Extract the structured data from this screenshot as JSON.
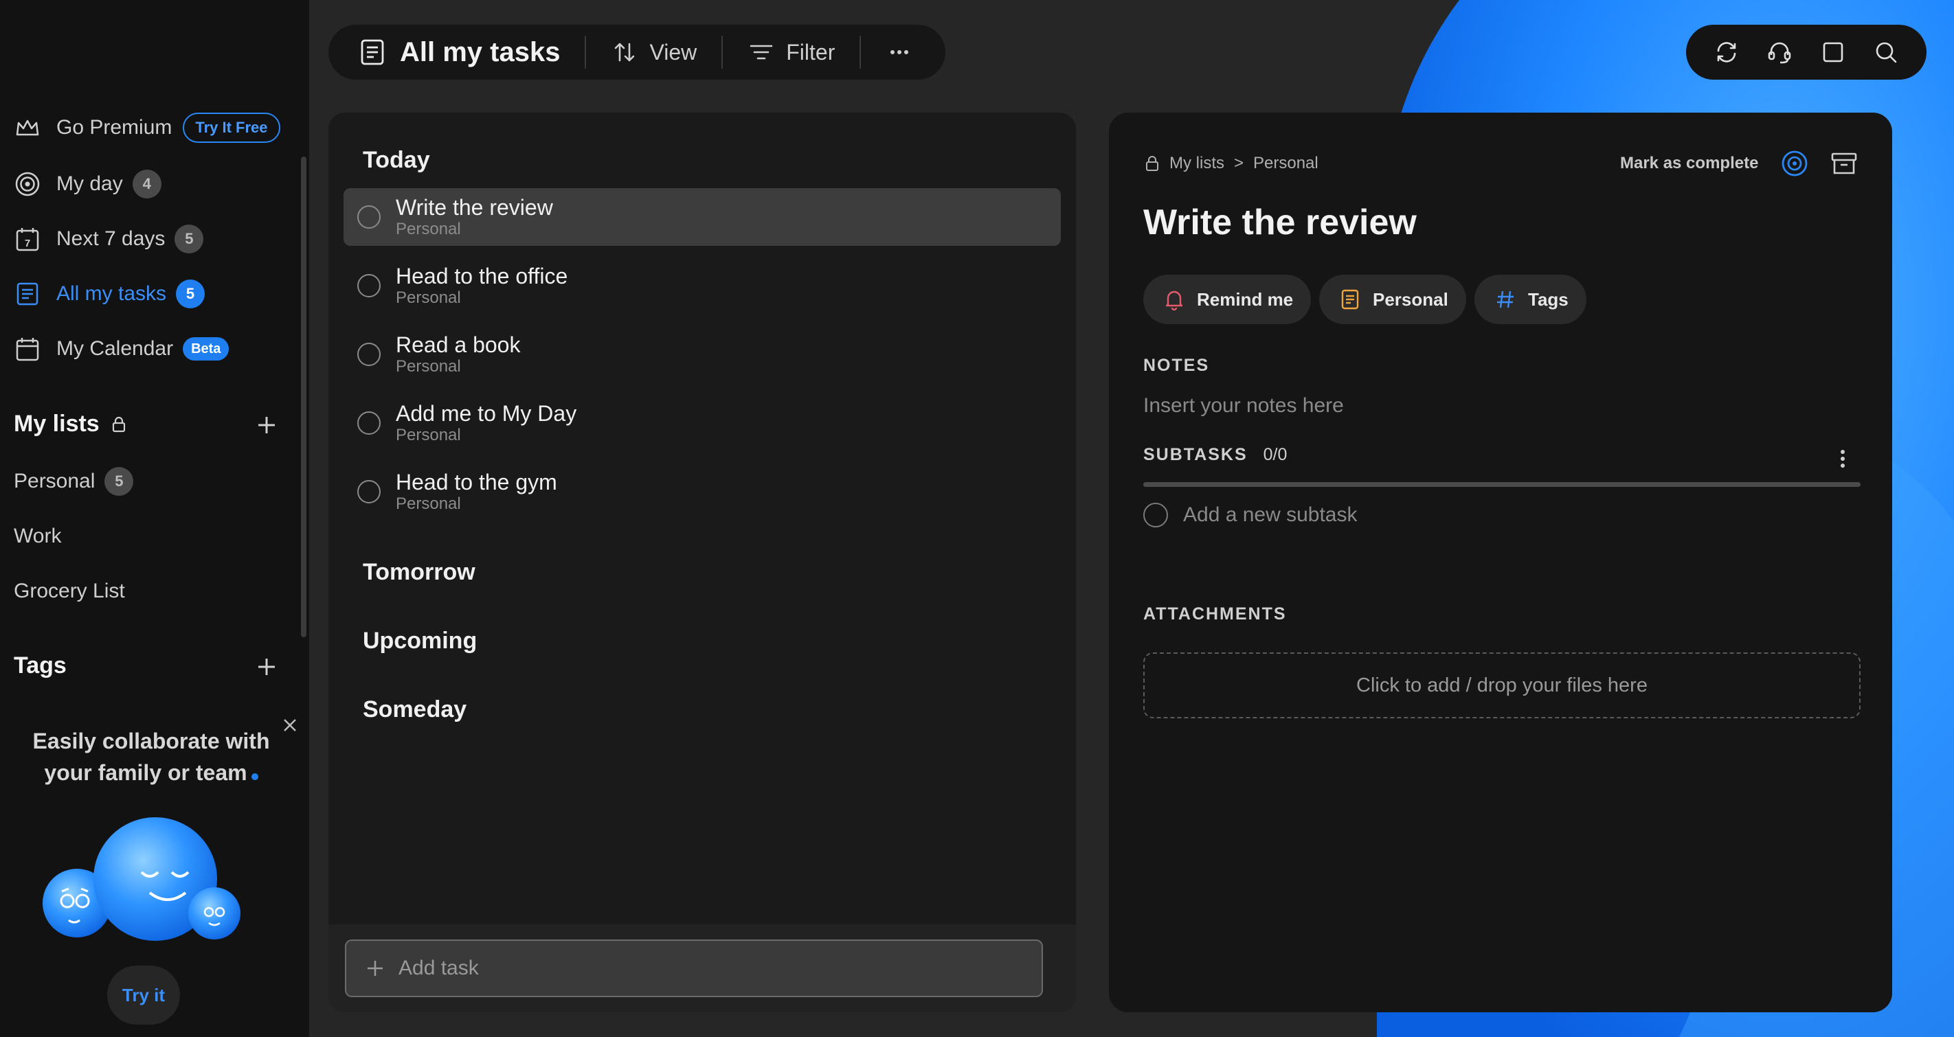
{
  "colors": {
    "accent": "#1f7ff0",
    "background": "#262626",
    "sidebar": "#121212",
    "panel": "#1a1a1a"
  },
  "sidebar": {
    "premium": {
      "label": "Go Premium",
      "badge": "Try It Free",
      "icon": "crown-icon"
    },
    "nav": [
      {
        "label": "My day",
        "count": "4",
        "icon": "target-icon"
      },
      {
        "label": "Next 7 days",
        "count": "5",
        "icon": "calendar-7-icon"
      },
      {
        "label": "All my tasks",
        "count": "5",
        "icon": "list-doc-icon",
        "active": true
      },
      {
        "label": "My Calendar",
        "badge": "Beta",
        "icon": "calendar-icon"
      }
    ],
    "my_lists": {
      "heading": "My lists",
      "items": [
        {
          "label": "Personal",
          "count": "5"
        },
        {
          "label": "Work"
        },
        {
          "label": "Grocery List"
        }
      ]
    },
    "tags": {
      "heading": "Tags"
    },
    "promo": {
      "line1": "Easily collaborate with",
      "line2": "your family or team",
      "button": "Try it"
    }
  },
  "toolbar": {
    "title": "All my tasks",
    "view_label": "View",
    "filter_label": "Filter"
  },
  "task_list": {
    "sections": [
      "Today",
      "Tomorrow",
      "Upcoming",
      "Someday"
    ],
    "today_tasks": [
      {
        "title": "Write the review",
        "list": "Personal",
        "selected": true
      },
      {
        "title": "Head to the office",
        "list": "Personal"
      },
      {
        "title": "Read a book",
        "list": "Personal"
      },
      {
        "title": "Add me to My Day",
        "list": "Personal"
      },
      {
        "title": "Head to the gym",
        "list": "Personal"
      }
    ],
    "add_task_placeholder": "Add task"
  },
  "detail": {
    "breadcrumb": [
      "My lists",
      ">",
      "Personal"
    ],
    "mark_complete": "Mark as complete",
    "title": "Write the review",
    "chips": {
      "remind": "Remind me",
      "list": "Personal",
      "tags": "Tags"
    },
    "notes_label": "NOTES",
    "notes_placeholder": "Insert your notes here",
    "subtasks_label": "SUBTASKS",
    "subtasks_count": "0/0",
    "subtasks_progress": 0,
    "add_subtask": "Add a new subtask",
    "attachments_label": "ATTACHMENTS",
    "dropzone": "Click to add / drop your files here"
  }
}
